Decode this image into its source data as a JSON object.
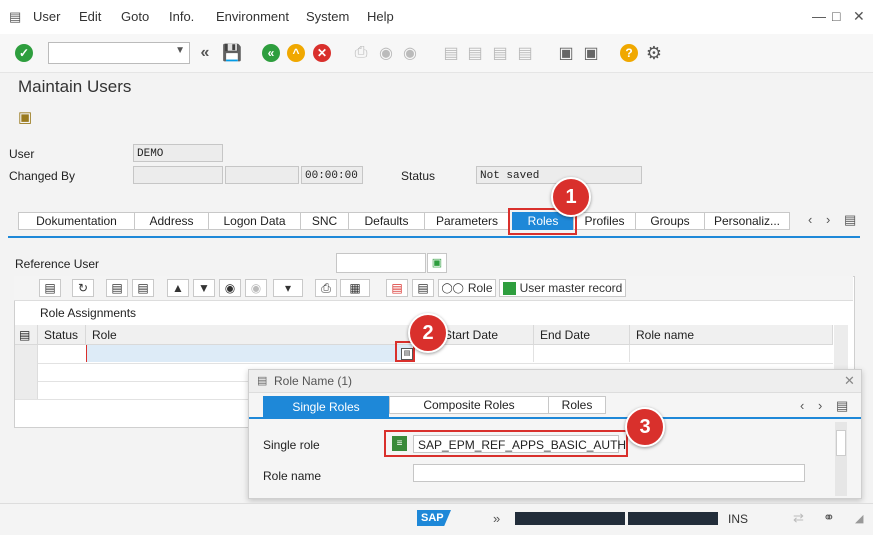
{
  "menu": [
    "User",
    "Edit",
    "Goto",
    "Info.",
    "Environment",
    "System",
    "Help"
  ],
  "page_title": "Maintain Users",
  "fields": {
    "user_label": "User",
    "user_value": "DEMO",
    "changed_by_label": "Changed By",
    "changed_time": "00:00:00",
    "status_label": "Status",
    "status_value": "Not saved"
  },
  "tabs": [
    "Dokumentation",
    "Address",
    "Logon Data",
    "SNC",
    "Defaults",
    "Parameters",
    "Roles",
    "Profiles",
    "Groups",
    "Personaliz..."
  ],
  "active_tab": "Roles",
  "reference_user_label": "Reference User",
  "grid_toolbar": {
    "role_button": "Role",
    "user_master_button": "User master record"
  },
  "role_assignments": {
    "title": "Role Assignments",
    "columns": [
      "Status",
      "Role",
      "Start Date",
      "End Date",
      "Role name"
    ]
  },
  "popup": {
    "title": "Role Name (1)",
    "tabs": [
      "Single Roles",
      "Composite Roles",
      "Roles"
    ],
    "single_role_label": "Single role",
    "single_role_value": "SAP_EPM_REF_APPS_BASIC_AUTH",
    "role_name_label": "Role name",
    "role_name_value": ""
  },
  "callouts": [
    "1",
    "2",
    "3"
  ],
  "statusbar": {
    "logo": "SAP",
    "chevrons": "»",
    "mode": "INS"
  },
  "colors": {
    "accent": "#1e88d8",
    "callout": "#d9302c",
    "ok_green": "#2e9e3e",
    "warn_yellow": "#f0a800",
    "cancel_red": "#d9302c"
  }
}
